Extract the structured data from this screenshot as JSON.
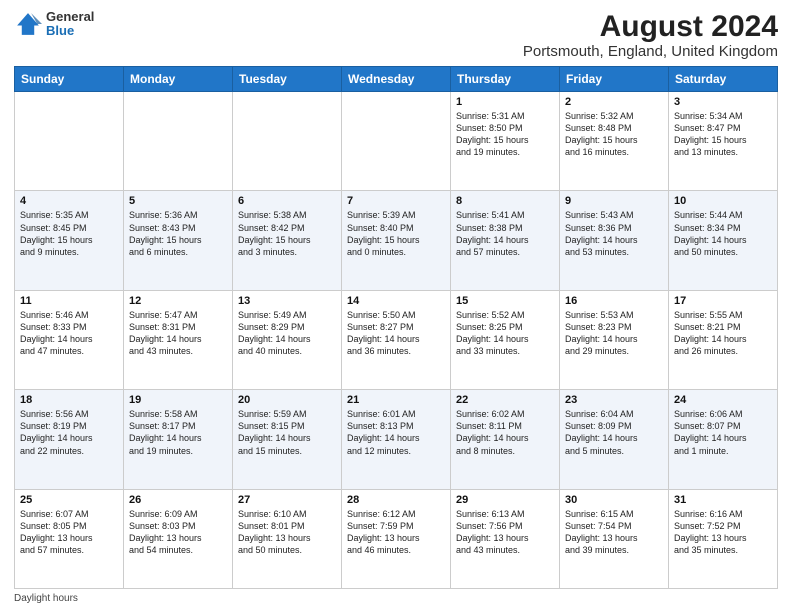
{
  "header": {
    "logo_general": "General",
    "logo_blue": "Blue",
    "title": "August 2024",
    "subtitle": "Portsmouth, England, United Kingdom"
  },
  "columns": [
    "Sunday",
    "Monday",
    "Tuesday",
    "Wednesday",
    "Thursday",
    "Friday",
    "Saturday"
  ],
  "weeks": [
    [
      {
        "day": "",
        "detail": ""
      },
      {
        "day": "",
        "detail": ""
      },
      {
        "day": "",
        "detail": ""
      },
      {
        "day": "",
        "detail": ""
      },
      {
        "day": "1",
        "detail": "Sunrise: 5:31 AM\nSunset: 8:50 PM\nDaylight: 15 hours\nand 19 minutes."
      },
      {
        "day": "2",
        "detail": "Sunrise: 5:32 AM\nSunset: 8:48 PM\nDaylight: 15 hours\nand 16 minutes."
      },
      {
        "day": "3",
        "detail": "Sunrise: 5:34 AM\nSunset: 8:47 PM\nDaylight: 15 hours\nand 13 minutes."
      }
    ],
    [
      {
        "day": "4",
        "detail": "Sunrise: 5:35 AM\nSunset: 8:45 PM\nDaylight: 15 hours\nand 9 minutes."
      },
      {
        "day": "5",
        "detail": "Sunrise: 5:36 AM\nSunset: 8:43 PM\nDaylight: 15 hours\nand 6 minutes."
      },
      {
        "day": "6",
        "detail": "Sunrise: 5:38 AM\nSunset: 8:42 PM\nDaylight: 15 hours\nand 3 minutes."
      },
      {
        "day": "7",
        "detail": "Sunrise: 5:39 AM\nSunset: 8:40 PM\nDaylight: 15 hours\nand 0 minutes."
      },
      {
        "day": "8",
        "detail": "Sunrise: 5:41 AM\nSunset: 8:38 PM\nDaylight: 14 hours\nand 57 minutes."
      },
      {
        "day": "9",
        "detail": "Sunrise: 5:43 AM\nSunset: 8:36 PM\nDaylight: 14 hours\nand 53 minutes."
      },
      {
        "day": "10",
        "detail": "Sunrise: 5:44 AM\nSunset: 8:34 PM\nDaylight: 14 hours\nand 50 minutes."
      }
    ],
    [
      {
        "day": "11",
        "detail": "Sunrise: 5:46 AM\nSunset: 8:33 PM\nDaylight: 14 hours\nand 47 minutes."
      },
      {
        "day": "12",
        "detail": "Sunrise: 5:47 AM\nSunset: 8:31 PM\nDaylight: 14 hours\nand 43 minutes."
      },
      {
        "day": "13",
        "detail": "Sunrise: 5:49 AM\nSunset: 8:29 PM\nDaylight: 14 hours\nand 40 minutes."
      },
      {
        "day": "14",
        "detail": "Sunrise: 5:50 AM\nSunset: 8:27 PM\nDaylight: 14 hours\nand 36 minutes."
      },
      {
        "day": "15",
        "detail": "Sunrise: 5:52 AM\nSunset: 8:25 PM\nDaylight: 14 hours\nand 33 minutes."
      },
      {
        "day": "16",
        "detail": "Sunrise: 5:53 AM\nSunset: 8:23 PM\nDaylight: 14 hours\nand 29 minutes."
      },
      {
        "day": "17",
        "detail": "Sunrise: 5:55 AM\nSunset: 8:21 PM\nDaylight: 14 hours\nand 26 minutes."
      }
    ],
    [
      {
        "day": "18",
        "detail": "Sunrise: 5:56 AM\nSunset: 8:19 PM\nDaylight: 14 hours\nand 22 minutes."
      },
      {
        "day": "19",
        "detail": "Sunrise: 5:58 AM\nSunset: 8:17 PM\nDaylight: 14 hours\nand 19 minutes."
      },
      {
        "day": "20",
        "detail": "Sunrise: 5:59 AM\nSunset: 8:15 PM\nDaylight: 14 hours\nand 15 minutes."
      },
      {
        "day": "21",
        "detail": "Sunrise: 6:01 AM\nSunset: 8:13 PM\nDaylight: 14 hours\nand 12 minutes."
      },
      {
        "day": "22",
        "detail": "Sunrise: 6:02 AM\nSunset: 8:11 PM\nDaylight: 14 hours\nand 8 minutes."
      },
      {
        "day": "23",
        "detail": "Sunrise: 6:04 AM\nSunset: 8:09 PM\nDaylight: 14 hours\nand 5 minutes."
      },
      {
        "day": "24",
        "detail": "Sunrise: 6:06 AM\nSunset: 8:07 PM\nDaylight: 14 hours\nand 1 minute."
      }
    ],
    [
      {
        "day": "25",
        "detail": "Sunrise: 6:07 AM\nSunset: 8:05 PM\nDaylight: 13 hours\nand 57 minutes."
      },
      {
        "day": "26",
        "detail": "Sunrise: 6:09 AM\nSunset: 8:03 PM\nDaylight: 13 hours\nand 54 minutes."
      },
      {
        "day": "27",
        "detail": "Sunrise: 6:10 AM\nSunset: 8:01 PM\nDaylight: 13 hours\nand 50 minutes."
      },
      {
        "day": "28",
        "detail": "Sunrise: 6:12 AM\nSunset: 7:59 PM\nDaylight: 13 hours\nand 46 minutes."
      },
      {
        "day": "29",
        "detail": "Sunrise: 6:13 AM\nSunset: 7:56 PM\nDaylight: 13 hours\nand 43 minutes."
      },
      {
        "day": "30",
        "detail": "Sunrise: 6:15 AM\nSunset: 7:54 PM\nDaylight: 13 hours\nand 39 minutes."
      },
      {
        "day": "31",
        "detail": "Sunrise: 6:16 AM\nSunset: 7:52 PM\nDaylight: 13 hours\nand 35 minutes."
      }
    ]
  ],
  "footer": "Daylight hours"
}
